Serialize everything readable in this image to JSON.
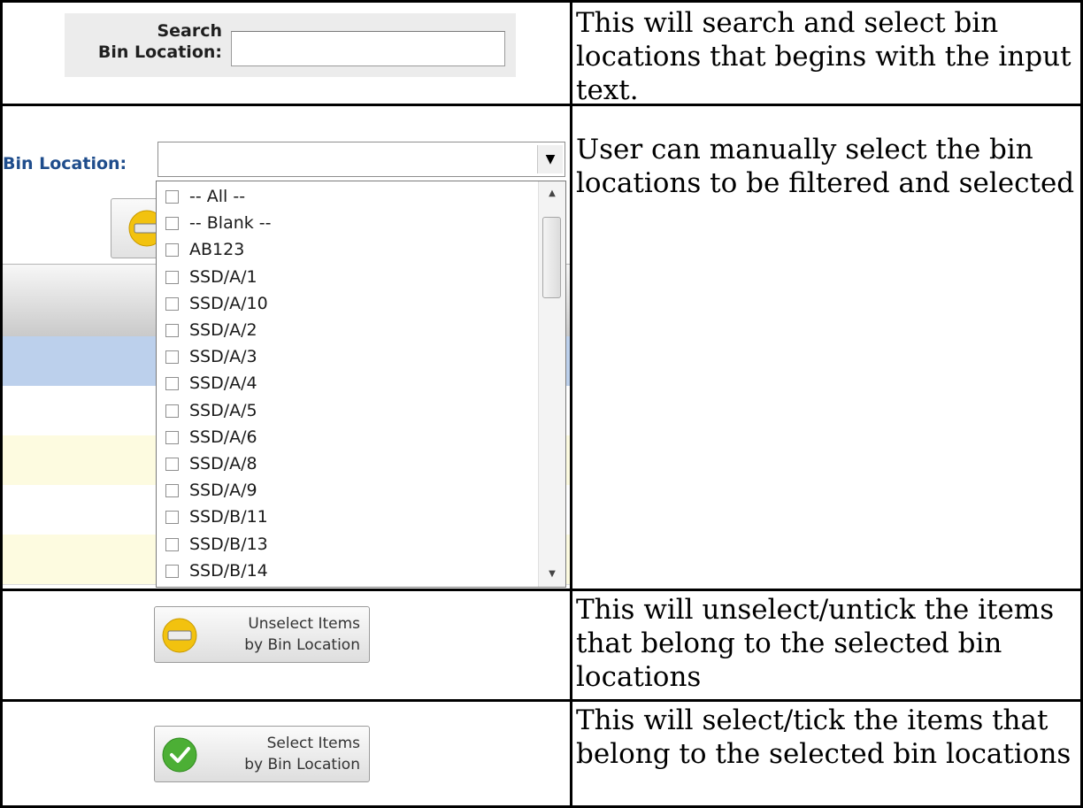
{
  "search": {
    "label_line1": "Search",
    "label_line2": "Bin Location:",
    "value": "",
    "description": "This will search and select bin locations that begins with the input text."
  },
  "bin_dropdown": {
    "label": "Bin Location:",
    "value": "",
    "options": [
      "-- All --",
      "-- Blank --",
      "AB123",
      "SSD/A/1",
      "SSD/A/10",
      "SSD/A/2",
      "SSD/A/3",
      "SSD/A/4",
      "SSD/A/5",
      "SSD/A/6",
      "SSD/A/8",
      "SSD/A/9",
      "SSD/B/11",
      "SSD/B/13",
      "SSD/B/14"
    ],
    "description": "User can manually select the bin locations to be filtered and selected"
  },
  "unselect_button": {
    "line1": "Unselect Items",
    "line2": "by Bin Location",
    "icon": "minus-circle-icon",
    "icon_color": "#f2c20f",
    "description": "This will unselect/untick the items that belong to the selected bin locations"
  },
  "select_button": {
    "line1": "Select Items",
    "line2": "by Bin Location",
    "icon": "check-circle-icon",
    "icon_color": "#4caf35",
    "description": "This will select/tick the items that belong to the selected bin locations"
  }
}
